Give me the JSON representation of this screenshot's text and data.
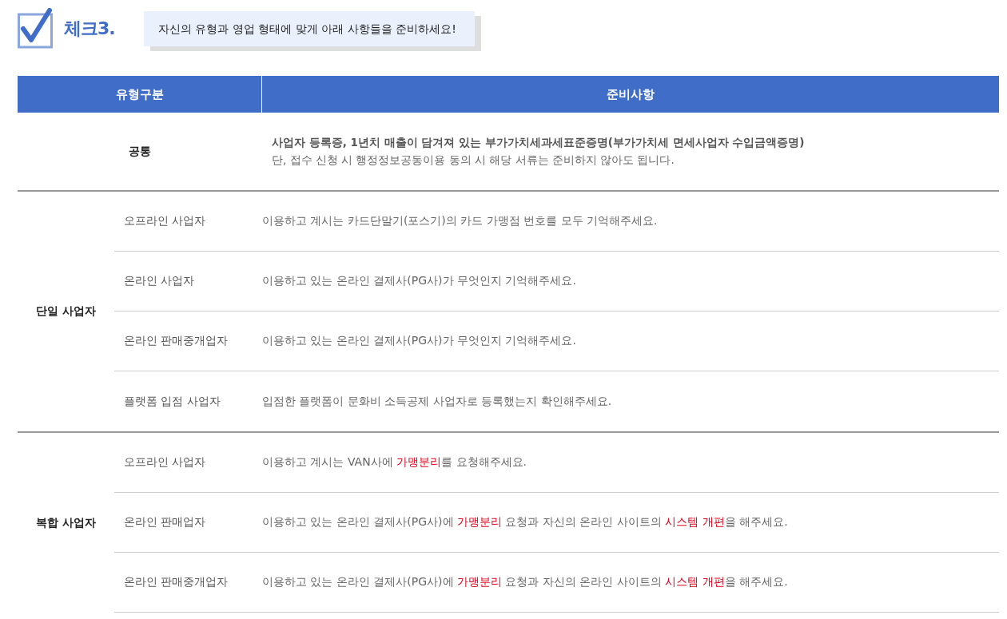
{
  "heading": {
    "label": "체크3.",
    "banner": "자신의 유형과 영업 형태에 맞게 아래 사항들을 준비하세요!"
  },
  "table": {
    "columns": [
      "유형구분",
      "준비사항"
    ],
    "common": {
      "type": "공통",
      "lines": [
        "사업자 등록증, 1년치 매출이 담겨져 있는 부가가치세과세표준증명(부가가치세 면세사업자 수입금액증명)",
        "단, 접수 신청 시 행정정보공동이용 동의 시 해당 서류는 준비하지 않아도 됩니다."
      ]
    },
    "groups": [
      {
        "name": "단일 사업자",
        "rows": [
          {
            "type": "오프라인 사업자",
            "text": "이용하고 계시는 카드단말기(포스기)의 카드 가맹점 번호를 모두 기억해주세요."
          },
          {
            "type": "온라인 사업자",
            "text": "이용하고 있는 온라인 결제사(PG사)가 무엇인지 기억해주세요."
          },
          {
            "type": "온라인 판매중개업자",
            "text": "이용하고 있는 온라인 결제사(PG사)가 무엇인지 기억해주세요."
          },
          {
            "type": "플랫폼 입점 사업자",
            "text": "입점한 플랫폼이 문화비 소득공제 사업자로 등록했는지 확인해주세요."
          }
        ]
      },
      {
        "name": "복합 사업자",
        "rows": [
          {
            "type": "오프라인 사업자",
            "text": "이용하고 계시는 VAN사에 **가맹분리**를 요청해주세요."
          },
          {
            "type": "온라인 판매업자",
            "text": "이용하고 있는 온라인 결제사(PG사)에 **가맹분리** 요청과 자신의 온라인 사이트의 **시스템 개편**을 해주세요."
          },
          {
            "type": "온라인 판매중개업자",
            "text": "이용하고 있는 온라인 결제사(PG사)에 **가맹분리** 요청과 자신의 온라인 사이트의 **시스템 개편**을 해주세요."
          }
        ]
      }
    ]
  }
}
